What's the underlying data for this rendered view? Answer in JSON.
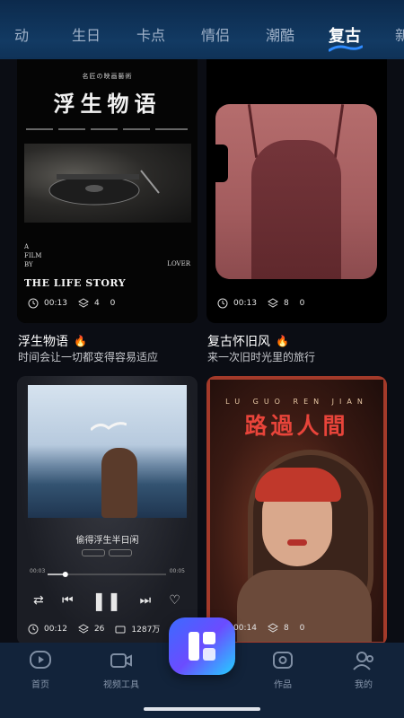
{
  "tabs": [
    "动",
    "生日",
    "卡点",
    "情侣",
    "潮酷",
    "复古",
    "新年"
  ],
  "active_tab": "复古",
  "accent_color": "#2f8bff",
  "cards": [
    {
      "poster_text": {
        "subtitle": "名匠の映画藝術",
        "title": "浮生物语",
        "film_lines": [
          "A",
          "FILM",
          "BY"
        ],
        "lover": "LOVER",
        "story": "THE LIFE STORY"
      },
      "duration": "00:13",
      "layers": "4",
      "uses": "0",
      "title": "浮生物语",
      "desc": "时间会让一切都变得容易适应",
      "hot_icon": "fire-icon"
    },
    {
      "duration": "00:13",
      "layers": "8",
      "uses": "0",
      "title": "复古怀旧风",
      "desc": "来一次旧时光里的旅行",
      "hot_icon": "fire-icon"
    },
    {
      "player": {
        "song": "偷得浮生半日闲",
        "time_start": "00:03",
        "time_end": "00:05",
        "progress": 0.15
      },
      "duration": "00:12",
      "layers": "26",
      "uses": "1287万"
    },
    {
      "poster_text": {
        "top": "LU GUO REN JIAN",
        "title": "路過人間"
      },
      "duration": "00:14",
      "layers": "8",
      "uses": "0"
    }
  ],
  "nav": {
    "home": "首页",
    "tools": "视频工具",
    "works": "作品",
    "mine": "我的"
  }
}
